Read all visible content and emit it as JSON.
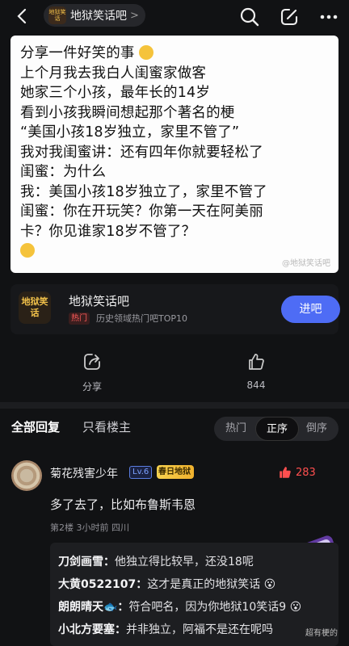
{
  "header": {
    "forum_logo_text": "地狱笑话",
    "forum_name": "地狱笑话吧",
    "arrow": ">"
  },
  "post": {
    "lines": [
      "分享一件好笑的事",
      "上个月我去我白人闺蜜家做客",
      "她家三个小孩，最年长的14岁",
      "看到小孩我瞬间想起那个著名的梗",
      "“美国小孩18岁独立，家里不管了”",
      "我对我闺蜜讲：还有四年你就要轻松了",
      "闺蜜：为什么",
      "我：美国小孩18岁独立了，家里不管了",
      "闺蜜：你在开玩笑？你第一天在阿美丽",
      "卡？你见谁家18岁不管了？"
    ],
    "watermark": "@地狱笑话吧"
  },
  "forum_card": {
    "logo_text": "地狱笑话",
    "name": "地狱笑话吧",
    "hot_badge": "热门",
    "desc": "历史领域热门吧TOP10",
    "enter": "进吧"
  },
  "actions": {
    "share": "分享",
    "like_count": "844"
  },
  "comment_tabs": {
    "all": "全部回复",
    "op_only": "只看楼主",
    "sort": [
      "热门",
      "正序",
      "倒序"
    ],
    "active_sort": "正序"
  },
  "comment": {
    "user": "菊花残害少年",
    "level": "Lv.6",
    "title_badge": "春日地狱",
    "likes": "283",
    "text": "多了去了，比如布鲁斯韦恩",
    "meta": "第2楼  3小时前  四川",
    "replies": [
      {
        "who": "刀剑画雪：",
        "text": "他独立得比较早，还没18呢"
      },
      {
        "who": "大黄0522107：",
        "text": "这才是真正的地狱笑话 😮"
      },
      {
        "who": "朗朗晴天🐟：",
        "text": "符合吧名，因为你地狱10笑话9 😮"
      },
      {
        "who": "小北方要塞：",
        "text": "并非独立，阿福不是还在呢吗"
      }
    ]
  },
  "bottom_watermark": "超有梗的"
}
